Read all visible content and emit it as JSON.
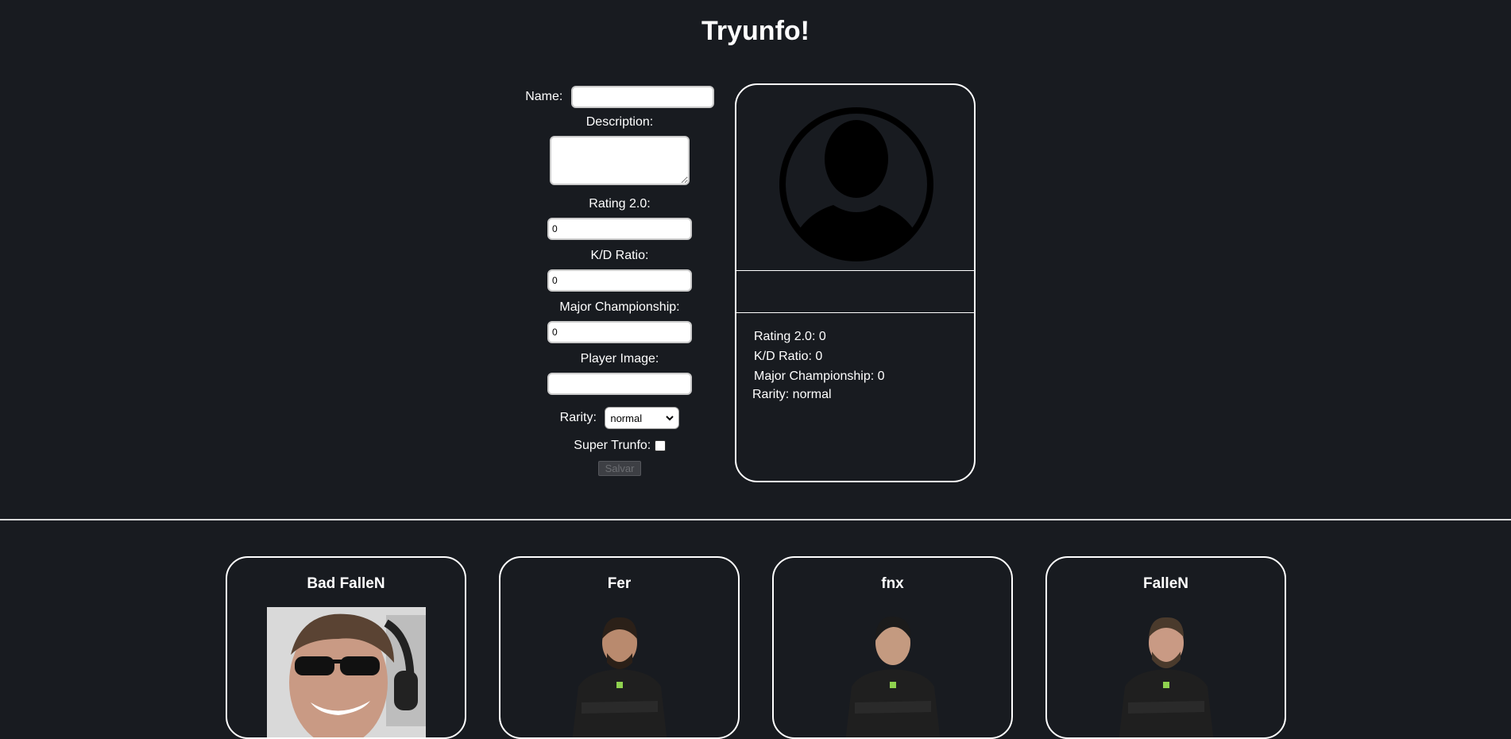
{
  "page": {
    "title": "Tryunfo!"
  },
  "form": {
    "name_label": "Name:",
    "name_value": "",
    "description_label": "Description:",
    "description_value": "",
    "rating_label": "Rating 2.0:",
    "rating_value": "0",
    "kd_label": "K/D Ratio:",
    "kd_value": "0",
    "major_label": "Major Championship:",
    "major_value": "0",
    "image_label": "Player Image:",
    "image_value": "",
    "rarity_label": "Rarity:",
    "rarity_value": "normal",
    "super_label": "Super Trunfo:",
    "super_checked": false,
    "save_label": "Salvar"
  },
  "preview": {
    "name": "",
    "rating_line": "Rating 2.0: 0",
    "kd_line": "K/D Ratio: 0",
    "major_line": "Major Championship: 0",
    "rarity_line": "Rarity: normal"
  },
  "cards": [
    {
      "name": "Bad FalleN",
      "photo_icon": "player-photo-webcam-sunglasses"
    },
    {
      "name": "Fer",
      "photo_icon": "player-photo-jersey"
    },
    {
      "name": "fnx",
      "photo_icon": "player-photo-jersey"
    },
    {
      "name": "FalleN",
      "photo_icon": "player-photo-jersey"
    }
  ],
  "colors": {
    "background": "#181b20",
    "border": "#ffffff",
    "jersey": "#1f1f1f",
    "accent": "#8fd14f"
  }
}
